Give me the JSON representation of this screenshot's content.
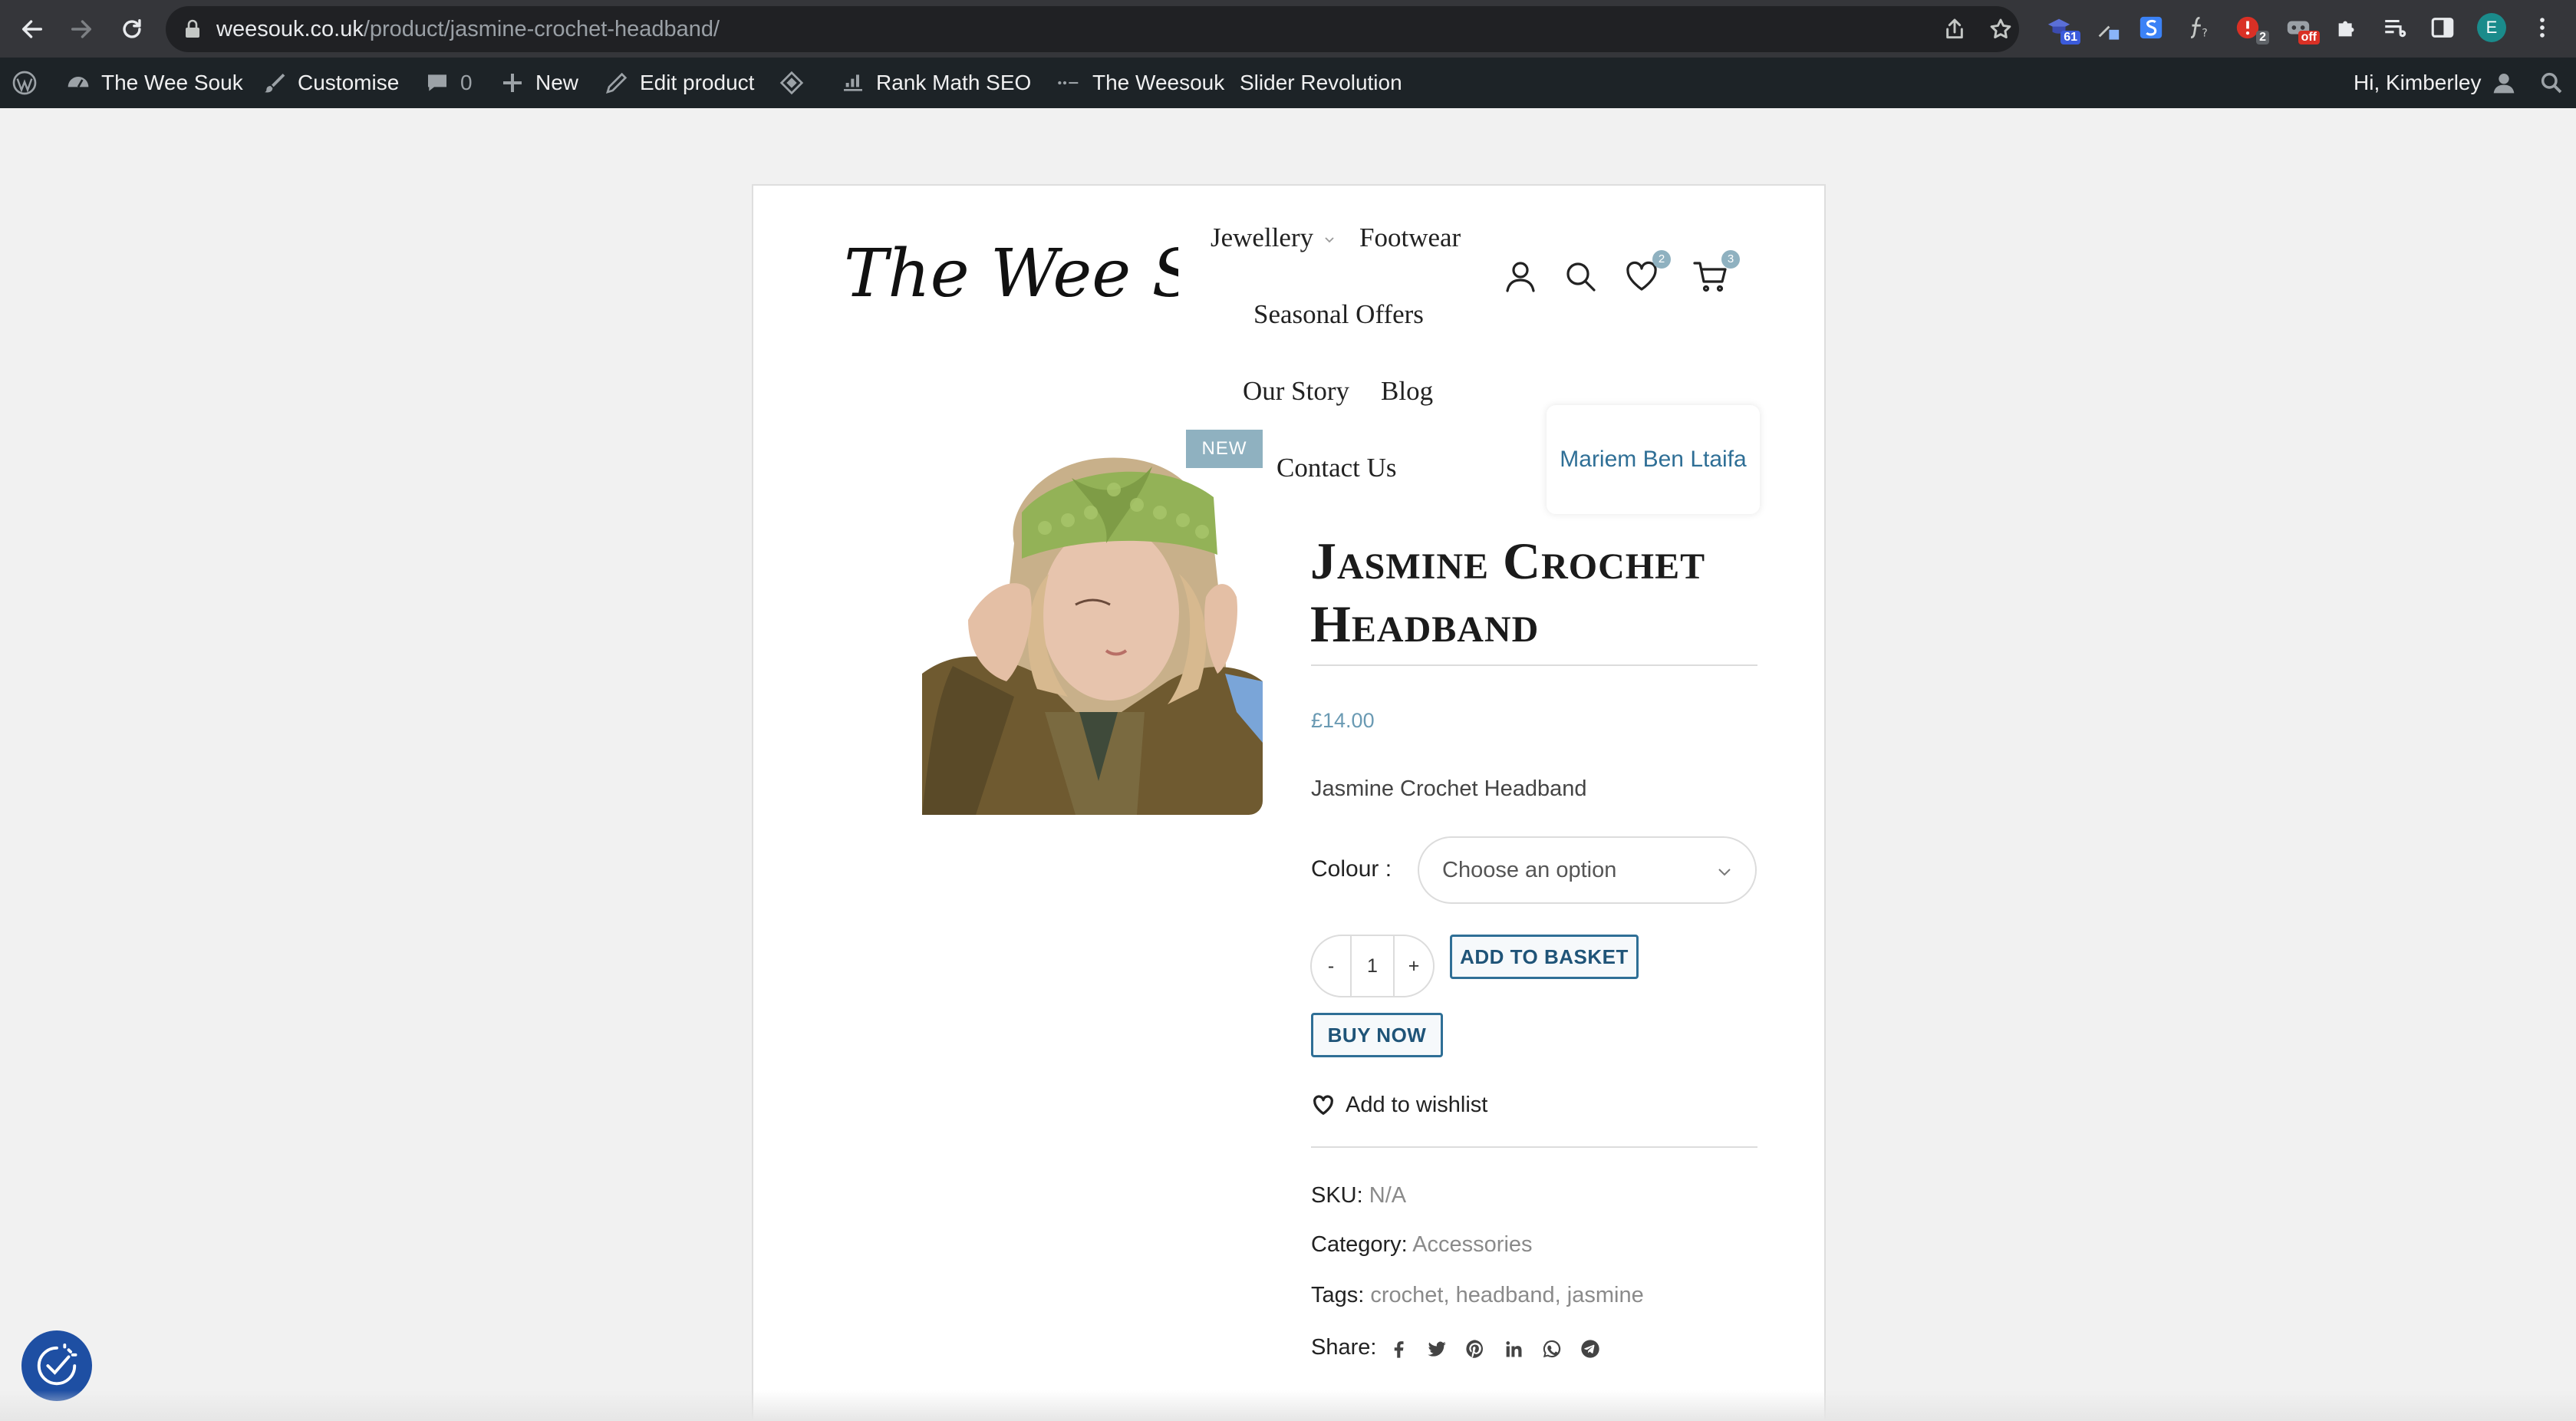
{
  "browser": {
    "url_domain": "weesouk.co.uk",
    "url_path": "/product/jasmine-crochet-headband/",
    "extensions": [
      {
        "name": "extension-icon-1",
        "badge": "61",
        "color": "#3b5bdb"
      },
      {
        "name": "extension-icon-2",
        "badge": "",
        "color": "#8ab4f8"
      },
      {
        "name": "extension-icon-s",
        "badge": "",
        "color": "#3b82f6"
      },
      {
        "name": "extension-icon-fontface",
        "badge": "",
        "color": "#c4c7c5"
      },
      {
        "name": "extension-icon-red",
        "badge": "2",
        "color": "#d93025"
      },
      {
        "name": "extension-icon-off",
        "badge": "off",
        "color": "#d93025"
      }
    ],
    "profile_initial": "E"
  },
  "adminbar": {
    "site_name": "The Wee Souk",
    "customise": "Customise",
    "comments_count": "0",
    "new": "New",
    "edit_product": "Edit product",
    "rank_math": "Rank Math SEO",
    "weesouk": "The Weesouk",
    "slider": "Slider Revolution",
    "greeting": "Hi, Kimberley"
  },
  "header": {
    "logo_text": "The Wee Souk",
    "menu": {
      "jewellery": "Jewellery",
      "footwear": "Footwear",
      "seasonal": "Seasonal Offers",
      "story": "Our Story",
      "blog": "Blog",
      "contact": "Contact Us"
    },
    "wishlist_count": "2",
    "cart_count": "3",
    "dropdown_user": "Mariem Ben Ltaifa"
  },
  "product": {
    "badge": "NEW",
    "title": "Jasmine Crochet Headband",
    "price": "£14.00",
    "short_description": "Jasmine Crochet Headband",
    "colour_label": "Colour",
    "colour_placeholder": "Choose an option",
    "qty_minus": "-",
    "qty_value": "1",
    "qty_plus": "+",
    "add_to_basket": "ADD TO BASKET",
    "buy_now": "BUY NOW",
    "wishlist": "Add to wishlist",
    "sku_label": "SKU:",
    "sku_value": "N/A",
    "category_label": "Category:",
    "category_value": "Accessories",
    "tags_label": "Tags:",
    "tags": [
      "crochet",
      "headband",
      "jasmine"
    ],
    "tag_sep": ",",
    "share_label": "Share:",
    "share_icons": [
      "facebook-icon",
      "twitter-icon",
      "pinterest-icon",
      "linkedin-icon",
      "whatsapp-icon",
      "telegram-icon"
    ]
  },
  "colors": {
    "accent_blue": "#2f6f96",
    "badge_blue": "#8fb1c0",
    "price": "#6a9ab3"
  }
}
